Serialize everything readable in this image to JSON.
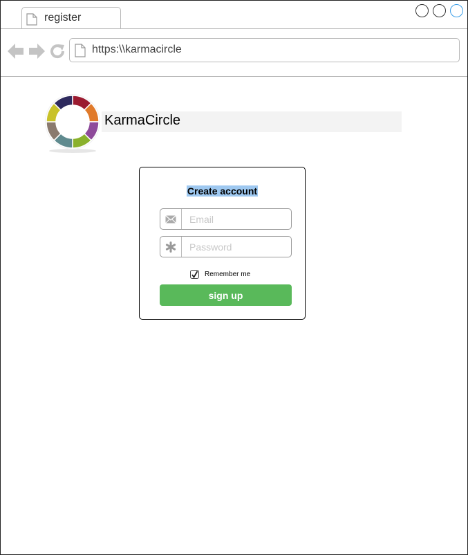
{
  "browser": {
    "tab_title": "register",
    "url": "https:\\\\karmacircle"
  },
  "brand": {
    "name": "KarmaCircle"
  },
  "signup_form": {
    "title": "Create account",
    "email_placeholder": "Email",
    "password_placeholder": "Password",
    "remember_label": "Remember me",
    "remember_checked": true,
    "submit_label": "sign up"
  },
  "colors": {
    "submit_button": "#59b95a",
    "title_highlight": "#9ec8f0"
  }
}
